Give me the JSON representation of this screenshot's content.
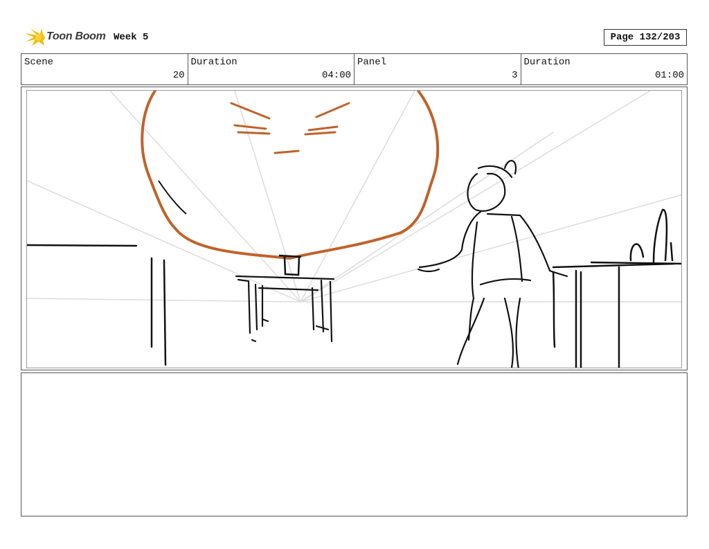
{
  "header": {
    "brand": "Toon Boom",
    "title": "Week 5",
    "page": "Page 132/203"
  },
  "info": [
    {
      "label": "Scene",
      "value": "20"
    },
    {
      "label": "Duration",
      "value": "04:00"
    },
    {
      "label": "Panel",
      "value": "3"
    },
    {
      "label": "Duration",
      "value": "01:00"
    }
  ],
  "colors": {
    "sketch_orange": "#c0622a",
    "sketch_black": "#111111",
    "guide_gray": "#dcdcdc",
    "logo_yellow": "#f5b800"
  },
  "notes": ""
}
